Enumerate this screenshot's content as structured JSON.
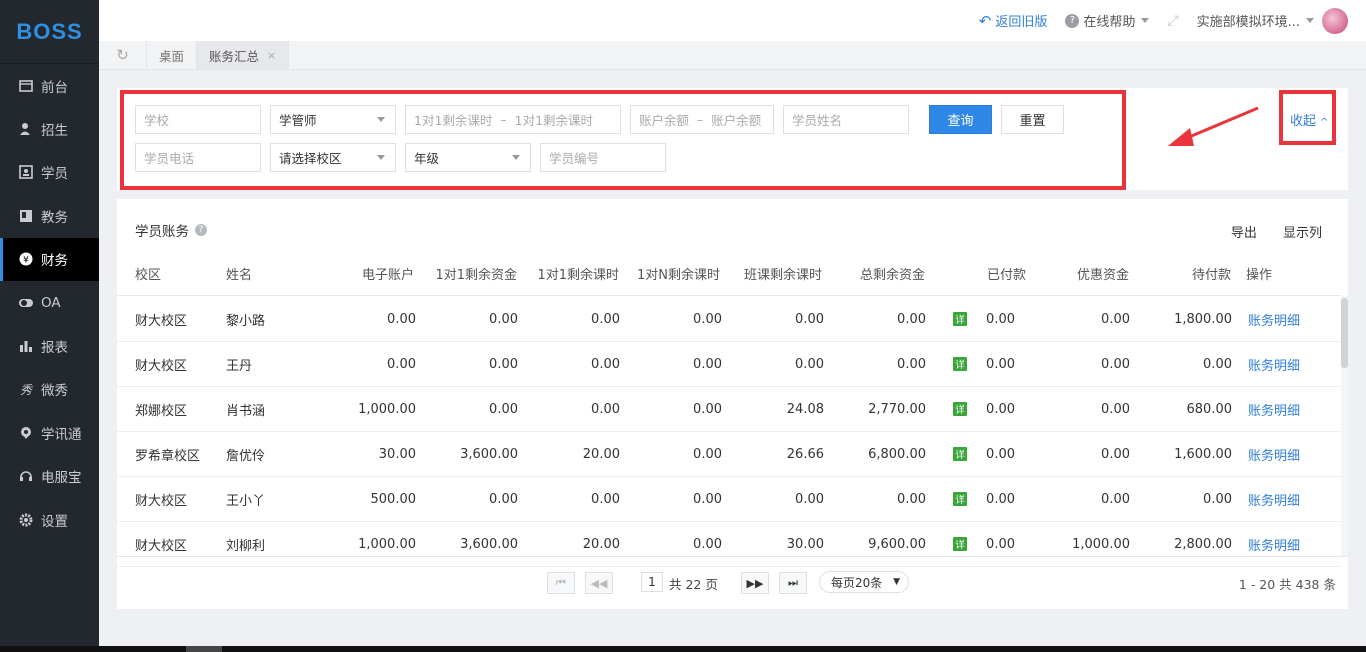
{
  "app": {
    "logo": "BOSS"
  },
  "sidebar": {
    "items": [
      {
        "label": "前台",
        "icon": "monitor-icon"
      },
      {
        "label": "招生",
        "icon": "user-plus-icon"
      },
      {
        "label": "学员",
        "icon": "id-card-icon"
      },
      {
        "label": "教务",
        "icon": "book-icon"
      },
      {
        "label": "财务",
        "icon": "yen-icon",
        "active": true
      },
      {
        "label": "OA",
        "icon": "toggle-icon"
      },
      {
        "label": "报表",
        "icon": "bar-chart-icon"
      },
      {
        "label": "微秀",
        "icon": "xiu-icon"
      },
      {
        "label": "学讯通",
        "icon": "location-icon"
      },
      {
        "label": "电服宝",
        "icon": "headset-icon"
      },
      {
        "label": "设置",
        "icon": "gear-icon"
      }
    ]
  },
  "topbar": {
    "back": "返回旧版",
    "help": "在线帮助",
    "user": "实施部模拟环境..."
  },
  "tabs": [
    {
      "label": "桌面"
    },
    {
      "label": "账务汇总",
      "active": true,
      "close": "×"
    }
  ],
  "filters": {
    "school_ph": "学校",
    "manager": "学管师",
    "one2one_from_ph": "1对1剩余课时",
    "dash": "–",
    "one2one_to_ph": "1对1剩余课时",
    "balance_from_ph": "账户余额",
    "balance_to_ph": "账户余额",
    "name_ph": "学员姓名",
    "search": "查询",
    "reset": "重置",
    "phone_ph": "学员电话",
    "campus": "请选择校区",
    "grade": "年级",
    "code_ph": "学员编号",
    "collapse": "收起"
  },
  "panel": {
    "title": "学员账务",
    "export": "导出",
    "columns_btn": "显示列"
  },
  "table": {
    "headers": [
      "校区",
      "姓名",
      "电子账户",
      "1对1剩余资金",
      "1对1剩余课时",
      "1对N剩余课时",
      "班课剩余课时",
      "总剩余资金",
      "已付款",
      "优惠资金",
      "待付款",
      "操作"
    ],
    "detail_badge": "详",
    "action": "账务明细",
    "rows": [
      [
        "财大校区",
        "黎小路",
        "0.00",
        "0.00",
        "0.00",
        "0.00",
        "0.00",
        "0.00",
        "0.00",
        "0.00",
        "1,800.00"
      ],
      [
        "财大校区",
        "王丹",
        "0.00",
        "0.00",
        "0.00",
        "0.00",
        "0.00",
        "0.00",
        "0.00",
        "0.00",
        "0.00"
      ],
      [
        "郑娜校区",
        "肖书涵",
        "1,000.00",
        "0.00",
        "0.00",
        "0.00",
        "24.08",
        "2,770.00",
        "0.00",
        "0.00",
        "680.00"
      ],
      [
        "罗希章校区",
        "詹优伶",
        "30.00",
        "3,600.00",
        "20.00",
        "0.00",
        "26.66",
        "6,800.00",
        "0.00",
        "0.00",
        "1,600.00"
      ],
      [
        "财大校区",
        "王小丫",
        "500.00",
        "0.00",
        "0.00",
        "0.00",
        "0.00",
        "0.00",
        "0.00",
        "0.00",
        "0.00"
      ],
      [
        "财大校区",
        "刘柳利",
        "1,000.00",
        "3,600.00",
        "20.00",
        "0.00",
        "30.00",
        "9,600.00",
        "0.00",
        "1,000.00",
        "2,800.00"
      ]
    ]
  },
  "pager": {
    "page": "1",
    "total_pages": "共 22 页",
    "page_size": "每页20条",
    "info": "1 - 20  共 438 条"
  },
  "colors": {
    "accent": "#2f88e8",
    "annotation": "#e8343b",
    "badge": "#3aa63a",
    "sidebar": "#23272e"
  }
}
